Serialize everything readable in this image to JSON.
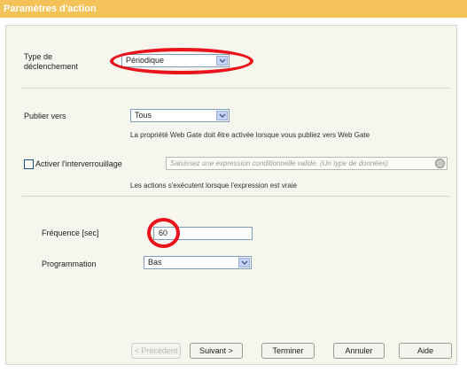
{
  "window": {
    "title": "Paramètres d'action"
  },
  "trigger": {
    "label_line1": "Type de",
    "label_line2": "déclenchement",
    "value": "Périodique"
  },
  "publish": {
    "label": "Publier vers",
    "value": "Tous",
    "note": "La propriété Web Gate doit être activée lorsque vous publiez vers Web Gate"
  },
  "interlock": {
    "checkbox_label": "Activer l'interverrouillage",
    "checked": false,
    "expression_placeholder": "Saisissez une expression conditionnelle valide. (Un type de données)",
    "note": "Les actions s'exécutent lorsque l'expression est vraie"
  },
  "frequency": {
    "label": "Fréquence [sec]",
    "value": "60"
  },
  "schedule": {
    "label": "Programmation",
    "value": "Bas"
  },
  "buttons": {
    "previous": "< Précédent",
    "next": "Suivant >",
    "finish": "Terminer",
    "cancel": "Annuler",
    "help": "Aide"
  },
  "colors": {
    "title_bar": "#f3c35a",
    "highlight": "#e8131b",
    "panel_bg": "#f6f5ee"
  },
  "icons": {
    "dropdown": "chevron-down-icon",
    "expression_button": "expression-builder-icon"
  }
}
